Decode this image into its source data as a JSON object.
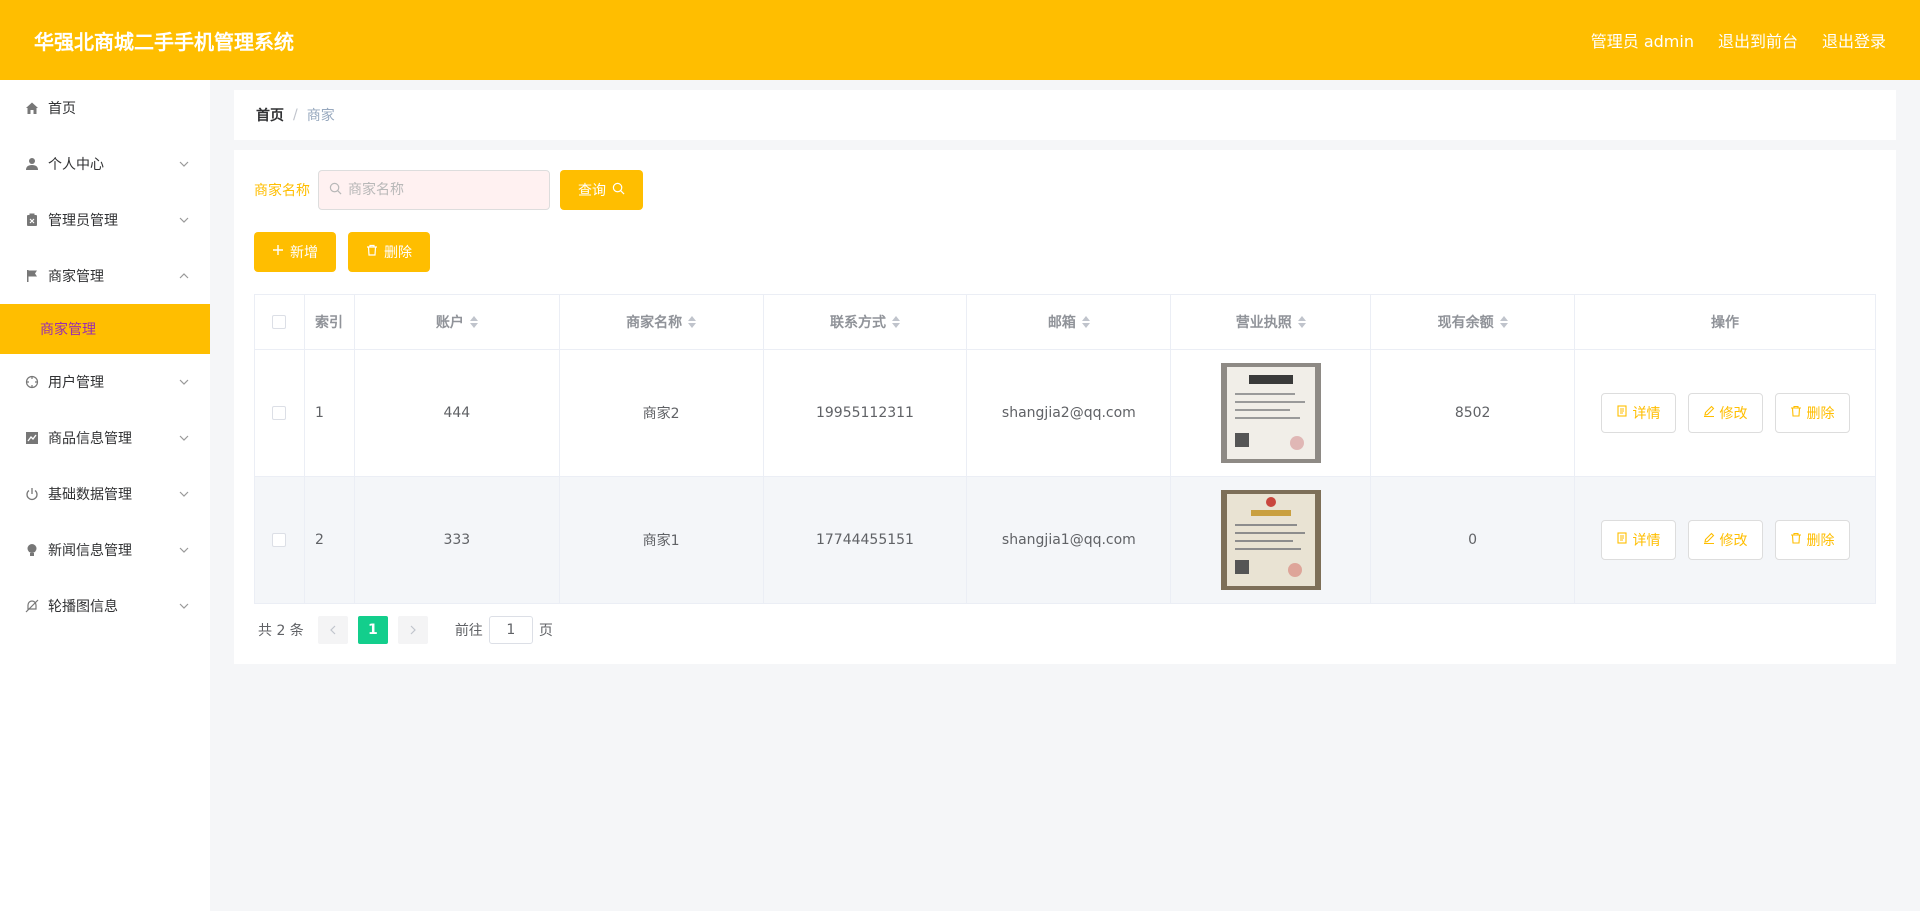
{
  "header": {
    "title": "华强北商城二手手机管理系统",
    "user": "管理员 admin",
    "to_front": "退出到前台",
    "logout": "退出登录"
  },
  "sidebar": {
    "items": [
      {
        "label": "首页",
        "icon": "home-icon"
      },
      {
        "label": "个人中心",
        "icon": "user-icon"
      },
      {
        "label": "管理员管理",
        "icon": "clipboard-icon"
      },
      {
        "label": "商家管理",
        "icon": "flag-icon"
      },
      {
        "label": "用户管理",
        "icon": "crosshair-icon"
      },
      {
        "label": "商品信息管理",
        "icon": "chart-icon"
      },
      {
        "label": "基础数据管理",
        "icon": "power-icon"
      },
      {
        "label": "新闻信息管理",
        "icon": "bulb-icon"
      },
      {
        "label": "轮播图信息",
        "icon": "bell-off-icon"
      }
    ],
    "active_sub": "商家管理"
  },
  "breadcrumb": {
    "home": "首页",
    "sep": "/",
    "current": "商家"
  },
  "search": {
    "label": "商家名称",
    "placeholder": "商家名称",
    "button": "查询"
  },
  "actions": {
    "add": "新增",
    "delete": "删除"
  },
  "table": {
    "headers": [
      "索引",
      "账户",
      "商家名称",
      "联系方式",
      "邮箱",
      "营业执照",
      "现有余额",
      "操作"
    ],
    "rows": [
      {
        "index": "1",
        "account": "444",
        "name": "商家2",
        "phone": "19955112311",
        "email": "shangjia2@qq.com",
        "balance": "8502"
      },
      {
        "index": "2",
        "account": "333",
        "name": "商家1",
        "phone": "17744455151",
        "email": "shangjia1@qq.com",
        "balance": "0"
      }
    ],
    "op_labels": {
      "detail": "详情",
      "edit": "修改",
      "delete": "删除"
    }
  },
  "pagination": {
    "total": "共 2 条",
    "current": "1",
    "goto": "前往",
    "page_value": "1",
    "page_unit": "页"
  },
  "colors": {
    "accent": "#ffbe00",
    "active_page": "#13ce8c",
    "active_sub_text": "#9b2fae"
  }
}
